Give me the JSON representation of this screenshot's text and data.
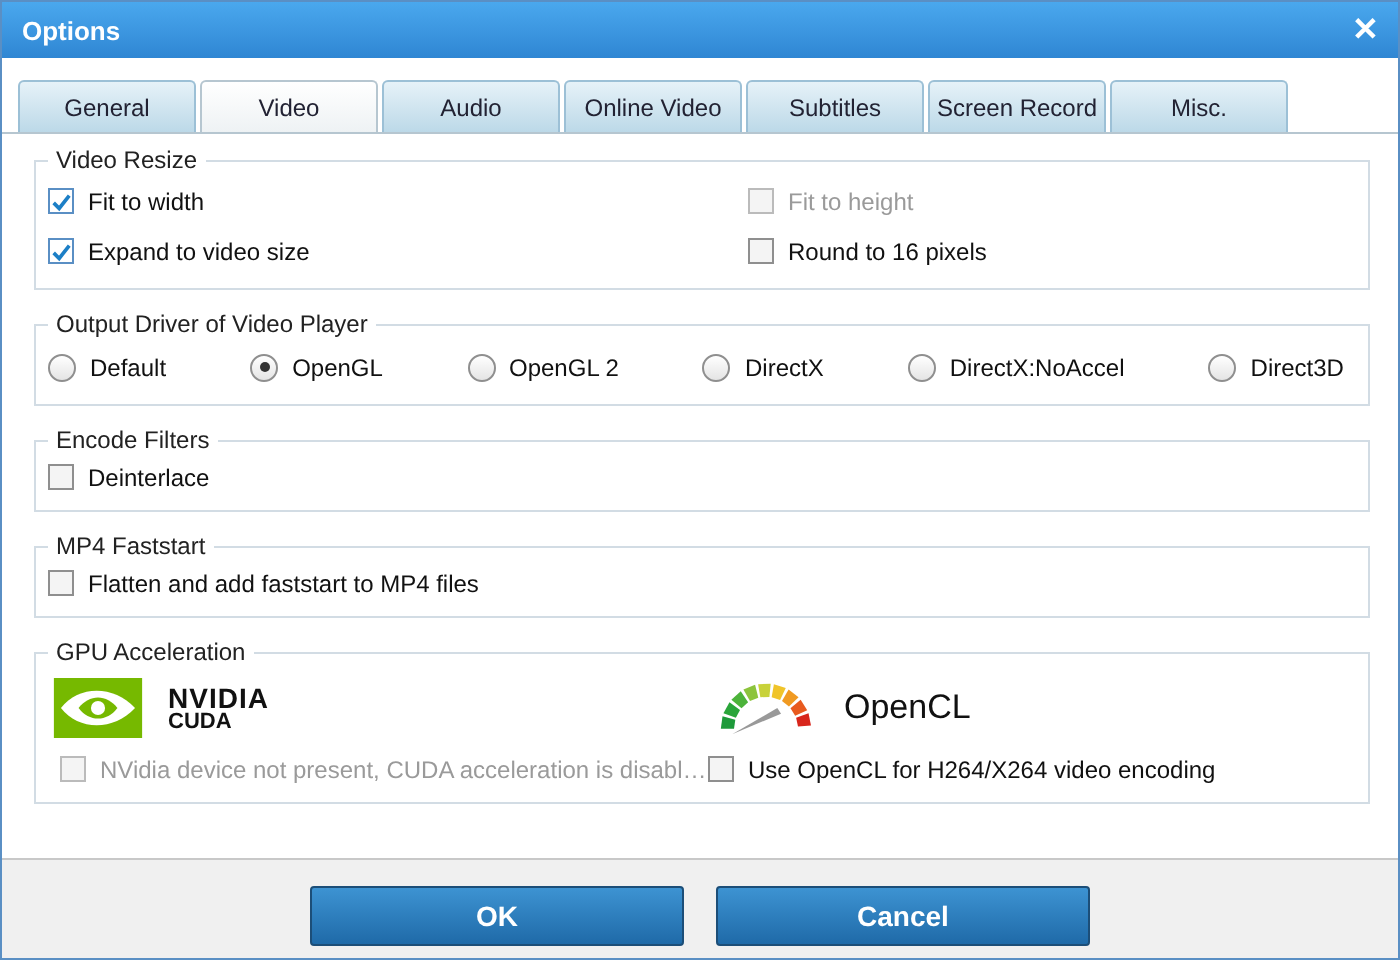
{
  "window": {
    "title": "Options",
    "close": "✕"
  },
  "tabs": [
    {
      "label": "General",
      "selected": false
    },
    {
      "label": "Video",
      "selected": true
    },
    {
      "label": "Audio",
      "selected": false
    },
    {
      "label": "Online Video",
      "selected": false
    },
    {
      "label": "Subtitles",
      "selected": false
    },
    {
      "label": "Screen Record",
      "selected": false
    },
    {
      "label": "Misc.",
      "selected": false
    }
  ],
  "video_resize": {
    "title": "Video Resize",
    "options": [
      {
        "label": "Fit to width",
        "checked": true,
        "disabled": false
      },
      {
        "label": "Fit to height",
        "checked": false,
        "disabled": true
      },
      {
        "label": "Expand to video size",
        "checked": true,
        "disabled": false
      },
      {
        "label": "Round to 16 pixels",
        "checked": false,
        "disabled": false
      }
    ]
  },
  "output_driver": {
    "title": "Output Driver of Video Player",
    "options": [
      {
        "label": "Default",
        "selected": false
      },
      {
        "label": "OpenGL",
        "selected": true
      },
      {
        "label": "OpenGL 2",
        "selected": false
      },
      {
        "label": "DirectX",
        "selected": false
      },
      {
        "label": "DirectX:NoAccel",
        "selected": false
      },
      {
        "label": "Direct3D",
        "selected": false
      }
    ]
  },
  "encode_filters": {
    "title": "Encode Filters",
    "options": [
      {
        "label": "Deinterlace",
        "checked": false,
        "disabled": false
      }
    ]
  },
  "mp4_faststart": {
    "title": "MP4 Faststart",
    "options": [
      {
        "label": "Flatten and add faststart to MP4 files",
        "checked": false,
        "disabled": false
      }
    ]
  },
  "gpu_acceleration": {
    "title": "GPU Acceleration",
    "cuda": {
      "logo_line_1": "NVIDIA",
      "logo_line_2": "CUDA",
      "option": {
        "label": "NVidia device not present, CUDA acceleration is disabl…",
        "checked": false,
        "disabled": true
      }
    },
    "opencl": {
      "logo": "OpenCL",
      "option": {
        "label": "Use OpenCL for H264/X264 video encoding",
        "checked": false,
        "disabled": false
      }
    }
  },
  "buttons": [
    "OK",
    "Cancel"
  ]
}
